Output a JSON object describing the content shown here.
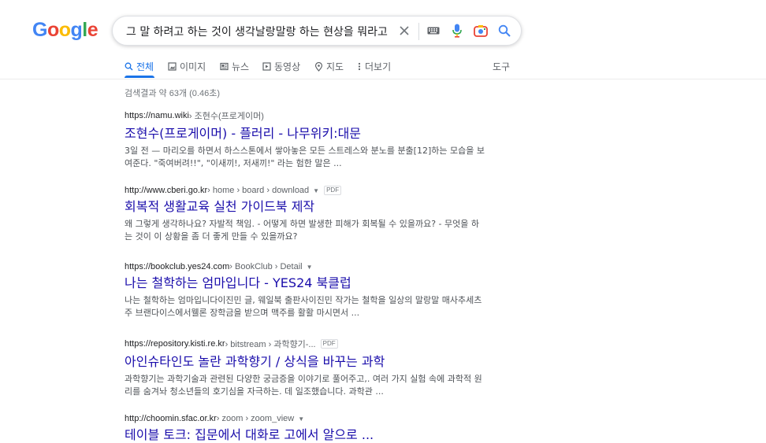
{
  "logo": {
    "text": "Google",
    "letters": [
      {
        "ch": "G",
        "color": "#4285f4"
      },
      {
        "ch": "o",
        "color": "#ea4335"
      },
      {
        "ch": "o",
        "color": "#fbbc05"
      },
      {
        "ch": "g",
        "color": "#4285f4"
      },
      {
        "ch": "l",
        "color": "#34a853"
      },
      {
        "ch": "e",
        "color": "#ea4335"
      }
    ]
  },
  "search": {
    "query": "그 말 하려고 하는 것이 생각날랑말랑 하는 현상을 뭐라고 하나요",
    "icons": [
      "close-icon",
      "keyboard-icon",
      "microphone-icon",
      "camera-icon",
      "search-icon"
    ]
  },
  "tabs": [
    {
      "label": "전체",
      "icon": "search-icon",
      "active": true
    },
    {
      "label": "이미지",
      "icon": "image-icon"
    },
    {
      "label": "뉴스",
      "icon": "news-icon"
    },
    {
      "label": "동영상",
      "icon": "video-icon"
    },
    {
      "label": "지도",
      "icon": "map-pin-icon"
    },
    {
      "label": "더보기",
      "icon": "more-vert-icon"
    }
  ],
  "tools_label": "도구",
  "stats": "검색결과 약 63개 (0.46초)",
  "results": [
    {
      "url": "https://namu.wiki",
      "crumbs": " › 조현수(프로게이머)",
      "title": "조현수(프로게이머) - 플러리 - 나무위키:대문",
      "snippet": "3일 전 — 마리오를 하면서 하스스톤에서 쌓아놓은 모든 스트레스와 분노를 분출[12]하는 모습을 보여준다. \"죽여버려!!\", \"이새끼!, 저새끼!\" 라는 험한 말은 ..."
    },
    {
      "url": "http://www.cberi.go.kr",
      "crumbs": " › home › board › download",
      "pdf": "PDF",
      "title": "회복적 생활교육 실천 가이드북 제작",
      "snippet": "왜 그렇게 생각하나요? 자발적 책임. - 어떻게 하면 발생한 피해가 회복될 수 있을까요? - 무엇을 하는 것이 이 상황을 좀 더 좋게 만들 수 있을까요?"
    },
    {
      "url": "https://bookclub.yes24.com",
      "crumbs": " › BookClub › Detail",
      "title": "나는 철학하는 엄마입니다 - YES24 북클럽",
      "snippet": "나는 철학하는 엄마입니다이진민 글, 웨일북 출판사이진민 작가는 철학을 일상의 말랑말 매사추세츠주 브랜다이스에서웰론 장학금을 받으며 맥주를 활활 마시면서 ..."
    },
    {
      "url": "https://repository.kisti.re.kr",
      "crumbs": " › bitstream › 과학향기-...",
      "pdf": "PDF",
      "title": "아인슈타인도 놀란 과학향기 / 상식을 바꾸는 과학",
      "snippet": "과학향기는 과학기술과 관련된 다양한 궁금증을 이야기로 풀어주고,. 여러 가지 실험 속에 과학적 원리를 숨겨놔 청소년들의 호기심을 자극하는. 데 일조했습니다. 과학관 ..."
    },
    {
      "url": "http://choomin.sfac.or.kr",
      "crumbs": " › zoom › zoom_view",
      "title": "테이블 토크: 집문에서 대화로 고에서 알으로 ...",
      "snippet": ""
    }
  ]
}
